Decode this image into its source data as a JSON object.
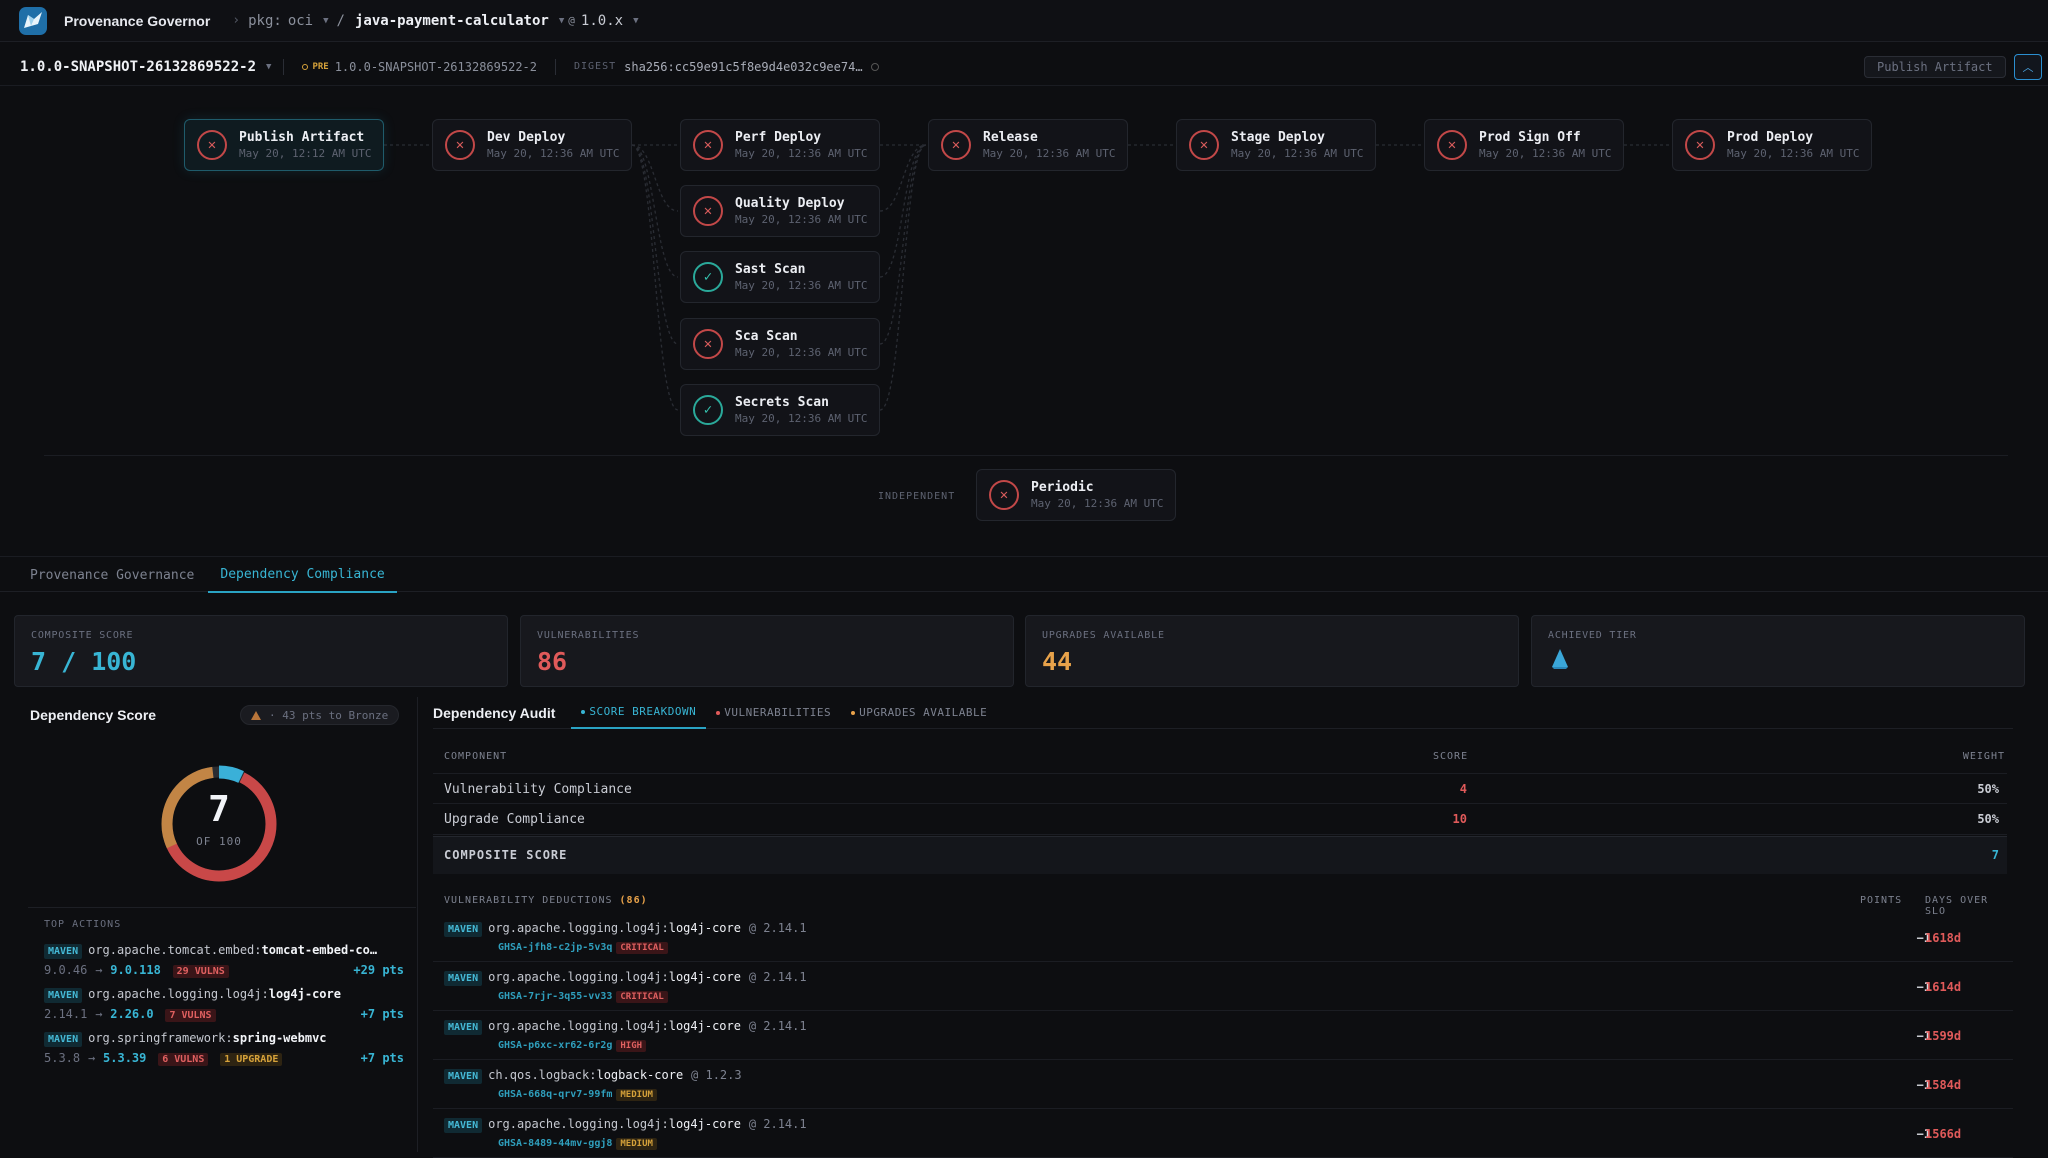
{
  "header": {
    "app_title": "Provenance Governor",
    "pkg_label": "pkg:",
    "pkg_type": "oci",
    "package_name": "java-payment-calculator",
    "at_symbol": "@",
    "version_range": "1.0.x"
  },
  "version_bar": {
    "version": "1.0.0-SNAPSHOT-26132869522-2",
    "pre_tag": "PRE",
    "pre_version": "1.0.0-SNAPSHOT-26132869522-2",
    "digest_label": "DIGEST",
    "digest": "sha256:cc59e91c5f8e9d4e032c9ee74…",
    "publish_button": "Publish Artifact"
  },
  "pipeline": {
    "stages": [
      {
        "name": "Publish Artifact",
        "time": "May 20, 12:12 AM UTC",
        "status": "fail"
      },
      {
        "name": "Dev Deploy",
        "time": "May 20, 12:36 AM UTC",
        "status": "fail"
      },
      {
        "name": "Perf Deploy",
        "time": "May 20, 12:36 AM UTC",
        "status": "fail"
      },
      {
        "name": "Quality Deploy",
        "time": "May 20, 12:36 AM UTC",
        "status": "fail"
      },
      {
        "name": "Sast Scan",
        "time": "May 20, 12:36 AM UTC",
        "status": "pass"
      },
      {
        "name": "Sca Scan",
        "time": "May 20, 12:36 AM UTC",
        "status": "fail"
      },
      {
        "name": "Secrets Scan",
        "time": "May 20, 12:36 AM UTC",
        "status": "pass"
      },
      {
        "name": "Release",
        "time": "May 20, 12:36 AM UTC",
        "status": "fail"
      },
      {
        "name": "Stage Deploy",
        "time": "May 20, 12:36 AM UTC",
        "status": "fail"
      },
      {
        "name": "Prod Sign Off",
        "time": "May 20, 12:36 AM UTC",
        "status": "fail"
      },
      {
        "name": "Prod Deploy",
        "time": "May 20, 12:36 AM UTC",
        "status": "fail"
      }
    ],
    "independent_label": "INDEPENDENT",
    "independent": {
      "name": "Periodic",
      "time": "May 20, 12:36 AM UTC",
      "status": "fail"
    }
  },
  "tabs": [
    {
      "label": "Provenance Governance",
      "active": false
    },
    {
      "label": "Dependency Compliance",
      "active": true
    }
  ],
  "stats": {
    "composite": {
      "label": "COMPOSITE SCORE",
      "value": "7 / 100",
      "color": "#38b5d4"
    },
    "vulnerabilities": {
      "label": "VULNERABILITIES",
      "value": "86",
      "color": "#e05a5a"
    },
    "upgrades": {
      "label": "UPGRADES AVAILABLE",
      "value": "44",
      "color": "#e8a24a"
    },
    "tier": {
      "label": "ACHIEVED TIER",
      "icon": "droplet-icon",
      "color": "#3aa6d8"
    }
  },
  "dependency_score": {
    "title": "Dependency Score",
    "bronze_hint": "· 43 pts to Bronze",
    "score": "7",
    "of_label": "OF 100",
    "score_fraction": 0.07,
    "top_actions_label": "TOP ACTIONS",
    "actions": [
      {
        "eco": "MAVEN",
        "group": "org.apache.tomcat.embed:",
        "artifact": "tomcat-embed-co…",
        "from": "9.0.46",
        "to": "9.0.118",
        "vulns": "29 VULNS",
        "upgrade": "",
        "pts": "+29 pts"
      },
      {
        "eco": "MAVEN",
        "group": "org.apache.logging.log4j:",
        "artifact": "log4j-core",
        "from": "2.14.1",
        "to": "2.26.0",
        "vulns": "7 VULNS",
        "upgrade": "",
        "pts": "+7 pts"
      },
      {
        "eco": "MAVEN",
        "group": "org.springframework:",
        "artifact": "spring-webmvc",
        "from": "5.3.8",
        "to": "5.3.39",
        "vulns": "6 VULNS",
        "upgrade": "1 UPGRADE",
        "pts": "+7 pts"
      }
    ]
  },
  "audit": {
    "title": "Dependency Audit",
    "tabs": [
      {
        "label": "SCORE BREAKDOWN",
        "active": true,
        "dot": "#38b5d4"
      },
      {
        "label": "VULNERABILITIES",
        "active": false,
        "dot": "#e05a5a"
      },
      {
        "label": "UPGRADES AVAILABLE",
        "active": false,
        "dot": "#e8a24a"
      }
    ],
    "columns": {
      "component": "COMPONENT",
      "score": "SCORE",
      "weight": "WEIGHT"
    },
    "rows": [
      {
        "component": "Vulnerability Compliance",
        "score": "4",
        "weight": "50%"
      },
      {
        "component": "Upgrade Compliance",
        "score": "10",
        "weight": "50%"
      }
    ],
    "composite_label": "COMPOSITE SCORE",
    "composite_value": "7",
    "deductions_label": "VULNERABILITY DEDUCTIONS",
    "deductions_count": "(86)",
    "points_col": "POINTS",
    "days_col": "DAYS OVER SLO",
    "deductions": [
      {
        "eco": "MAVEN",
        "group": "org.apache.logging.log4j:",
        "artifact": "log4j-core",
        "version": "@ 2.14.1",
        "ghsa": "GHSA-jfh8-c2jp-5v3q",
        "severity": "CRITICAL",
        "points": "−1",
        "days": "1618d"
      },
      {
        "eco": "MAVEN",
        "group": "org.apache.logging.log4j:",
        "artifact": "log4j-core",
        "version": "@ 2.14.1",
        "ghsa": "GHSA-7rjr-3q55-vv33",
        "severity": "CRITICAL",
        "points": "−1",
        "days": "1614d"
      },
      {
        "eco": "MAVEN",
        "group": "org.apache.logging.log4j:",
        "artifact": "log4j-core",
        "version": "@ 2.14.1",
        "ghsa": "GHSA-p6xc-xr62-6r2g",
        "severity": "HIGH",
        "points": "−1",
        "days": "1599d"
      },
      {
        "eco": "MAVEN",
        "group": "ch.qos.logback:",
        "artifact": "logback-core",
        "version": "@ 1.2.3",
        "ghsa": "GHSA-668q-qrv7-99fm",
        "severity": "MEDIUM",
        "points": "−1",
        "days": "1584d"
      },
      {
        "eco": "MAVEN",
        "group": "org.apache.logging.log4j:",
        "artifact": "log4j-core",
        "version": "@ 2.14.1",
        "ghsa": "GHSA-8489-44mv-ggj8",
        "severity": "MEDIUM",
        "points": "−1",
        "days": "1566d"
      }
    ]
  }
}
